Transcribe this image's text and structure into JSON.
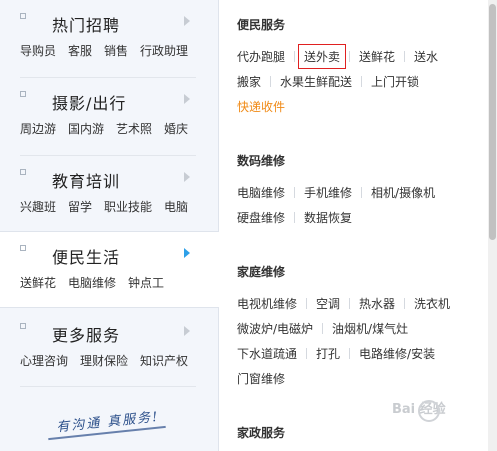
{
  "sidebar": {
    "categories": [
      {
        "title": "热门招聘",
        "links": [
          "导购员",
          "客服",
          "销售",
          "行政助理"
        ]
      },
      {
        "title": "摄影/出行",
        "links": [
          "周边游",
          "国内游",
          "艺术照",
          "婚庆"
        ]
      },
      {
        "title": "教育培训",
        "links": [
          "兴趣班",
          "留学",
          "职业技能",
          "电脑"
        ]
      },
      {
        "title": "便民生活",
        "links": [
          "送鲜花",
          "电脑维修",
          "钟点工"
        ]
      },
      {
        "title": "更多服务",
        "links": [
          "心理咨询",
          "理财保险",
          "知识产权"
        ]
      }
    ],
    "slogan": "有沟通 真服务!"
  },
  "panel": {
    "sections": [
      {
        "title": "便民服务",
        "rows": [
          [
            "代办跑腿",
            "送外卖",
            "送鲜花",
            "送水"
          ],
          [
            "搬家",
            "水果生鲜配送",
            "上门开锁"
          ],
          [
            "快递收件"
          ]
        ]
      },
      {
        "title": "数码维修",
        "rows": [
          [
            "电脑维修",
            "手机维修",
            "相机/摄像机"
          ],
          [
            "硬盘维修",
            "数据恢复"
          ]
        ]
      },
      {
        "title": "家庭维修",
        "rows": [
          [
            "电视机维修",
            "空调",
            "热水器",
            "洗衣机"
          ],
          [
            "微波炉/电磁炉",
            "油烟机/煤气灶"
          ],
          [
            "下水道疏通",
            "打孔",
            "电路维修/安装"
          ],
          [
            "门窗维修"
          ]
        ]
      },
      {
        "title": "家政服务"
      }
    ]
  },
  "watermark": "Bai 经验",
  "colors": {
    "accent": "#2ea0e8",
    "highlight": "#f08a16",
    "active_border": "#e02020"
  }
}
